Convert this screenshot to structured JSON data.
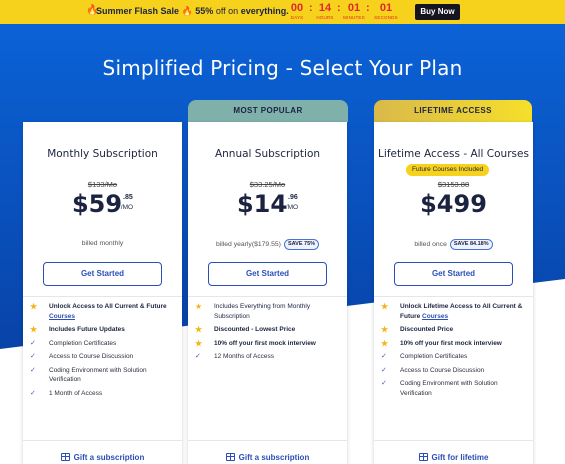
{
  "banner": {
    "sale_label": "Summer Flash Sale",
    "discount": "55%",
    "discount_suffix": "off on",
    "scope": "everything.",
    "timer": [
      {
        "value": "00",
        "unit": "DAYS"
      },
      {
        "value": "14",
        "unit": "HOURS"
      },
      {
        "value": "01",
        "unit": "MINUTES"
      },
      {
        "value": "01",
        "unit": "SECONDS"
      }
    ],
    "buy_label": "Buy Now"
  },
  "headline": "Simplified Pricing - Select Your Plan",
  "colors": {
    "banner_yellow": "#f7d21c",
    "hero_blue": "#0a55c8",
    "popular_tag": "#7fb1aa",
    "lifetime_tag": "#e8c93c",
    "accent_blue": "#2c4fb6",
    "star": "#f2b418",
    "countdown_red": "#e3262d"
  },
  "plans": [
    {
      "tag": "",
      "title": "Monthly Subscription",
      "pill": "",
      "old_price": "$133/Mo",
      "price_whole": "$59",
      "price_cents": ".85",
      "price_per": "/MO",
      "billing": "billed monthly",
      "save": "",
      "cta": "Get Started",
      "features": [
        {
          "icon": "star-icon",
          "text": "Unlock Access to All Current & Future",
          "link": "Courses"
        },
        {
          "icon": "star-icon",
          "text": "Includes Future Updates",
          "link": ""
        },
        {
          "icon": "check-icon",
          "text": "Completion Certificates",
          "link": ""
        },
        {
          "icon": "check-icon",
          "text": "Access to Course Discussion",
          "link": ""
        },
        {
          "icon": "check-icon",
          "text": "Coding Environment with Solution Verification",
          "link": ""
        },
        {
          "icon": "check-icon",
          "text": "1 Month of Access",
          "link": ""
        }
      ],
      "gift": "Gift a subscription"
    },
    {
      "tag": "MOST POPULAR",
      "title": "Annual Subscription",
      "pill": "",
      "old_price": "$33.25/Mo",
      "price_whole": "$14",
      "price_cents": ".96",
      "price_per": "/MO",
      "billing": "billed yearly($179.55)",
      "save": "SAVE 75%",
      "cta": "Get Started",
      "features": [
        {
          "icon": "star-icon",
          "text": "Includes Everything from Monthly Subscription",
          "link": ""
        },
        {
          "icon": "star-icon",
          "text": "Discounted - Lowest Price",
          "link": ""
        },
        {
          "icon": "star-icon",
          "text": "10% off your first mock interview",
          "link": ""
        },
        {
          "icon": "check-icon",
          "text": "12 Months of Access",
          "link": ""
        }
      ],
      "gift": "Gift a subscription"
    },
    {
      "tag": "LIFETIME ACCESS",
      "title": "Lifetime Access - All Courses",
      "pill": "Future Courses Included",
      "old_price": "$3153.88",
      "price_whole": "$499",
      "price_cents": "",
      "price_per": "",
      "billing": "billed once",
      "save": "SAVE 84.18%",
      "cta": "Get Started",
      "features": [
        {
          "icon": "star-icon",
          "text": "Unlock Lifetime Access to All Current & Future",
          "link": "Courses"
        },
        {
          "icon": "star-icon",
          "text": "Discounted Price",
          "link": ""
        },
        {
          "icon": "star-icon",
          "text": "10% off your first mock interview",
          "link": ""
        },
        {
          "icon": "check-icon",
          "text": "Completion Certificates",
          "link": ""
        },
        {
          "icon": "check-icon",
          "text": "Access to Course Discussion",
          "link": ""
        },
        {
          "icon": "check-icon",
          "text": "Coding Environment with Solution Verification",
          "link": ""
        }
      ],
      "gift": "Gift for lifetime"
    }
  ]
}
